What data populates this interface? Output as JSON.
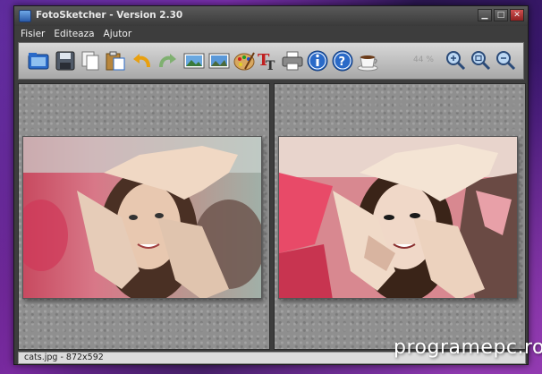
{
  "window": {
    "title": "FotoSketcher - Version 2.30"
  },
  "menu": [
    "Fisier",
    "Editeaza",
    "Ajutor"
  ],
  "toolbar": {
    "buttons": [
      "open-image-icon",
      "save-icon",
      "copy-icon",
      "paste-icon",
      "undo-icon",
      "redo-icon",
      "original-picture-icon",
      "result-picture-icon",
      "palette-icon",
      "text-icon",
      "print-icon",
      "info-icon",
      "help-icon",
      "coffee-icon",
      "zoom-in-icon",
      "zoom-fit-icon",
      "zoom-out-icon"
    ],
    "zoom_value": "44 %"
  },
  "panels": {
    "left": {
      "name": "original-image"
    },
    "right": {
      "name": "sketched-image"
    }
  },
  "status": {
    "text": "cats.jpg - 872x592"
  },
  "watermark": "programepc.ro",
  "colors": {
    "toolbar_blue": "#2a6ac8",
    "window_bg": "#3d3d3d",
    "panel_bg": "#8f8f8f"
  }
}
